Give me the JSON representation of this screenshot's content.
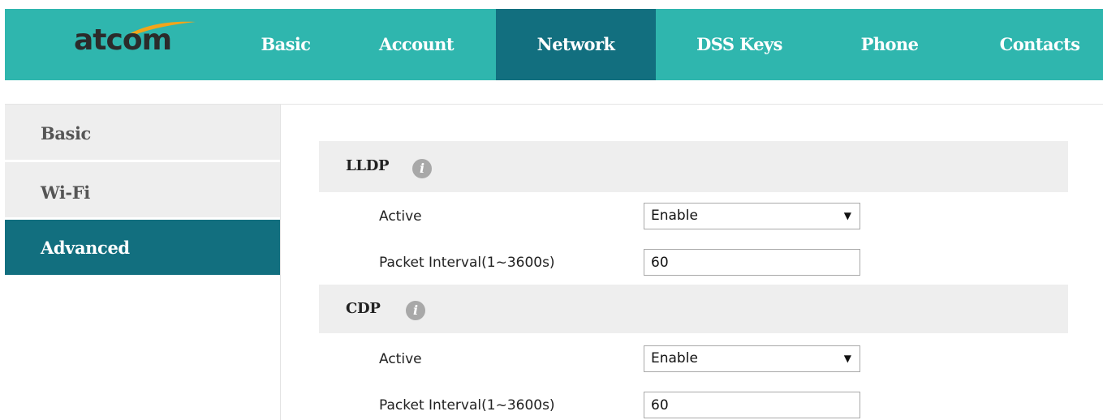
{
  "brand": {
    "logo_text": "atcom"
  },
  "nav": {
    "tabs": [
      {
        "label": "Basic"
      },
      {
        "label": "Account"
      },
      {
        "label": "Network",
        "active": true
      },
      {
        "label": "DSS Keys"
      },
      {
        "label": "Phone"
      },
      {
        "label": "Contacts"
      }
    ]
  },
  "sidebar": {
    "items": [
      {
        "label": "Basic"
      },
      {
        "label": "Wi-Fi"
      },
      {
        "label": "Advanced",
        "active": true
      }
    ]
  },
  "sections": {
    "lldp": {
      "title": "LLDP",
      "info_icon": "info-icon",
      "active_label": "Active",
      "active_value": "Enable",
      "interval_label": "Packet Interval(1~3600s)",
      "interval_value": "60"
    },
    "cdp": {
      "title": "CDP",
      "info_icon": "info-icon",
      "active_label": "Active",
      "active_value": "Enable",
      "interval_label": "Packet Interval(1~3600s)",
      "interval_value": "60"
    }
  },
  "colors": {
    "nav_bg": "#2fb6ae",
    "active_bg": "#126f7f",
    "panel_bg": "#eeeeee"
  }
}
